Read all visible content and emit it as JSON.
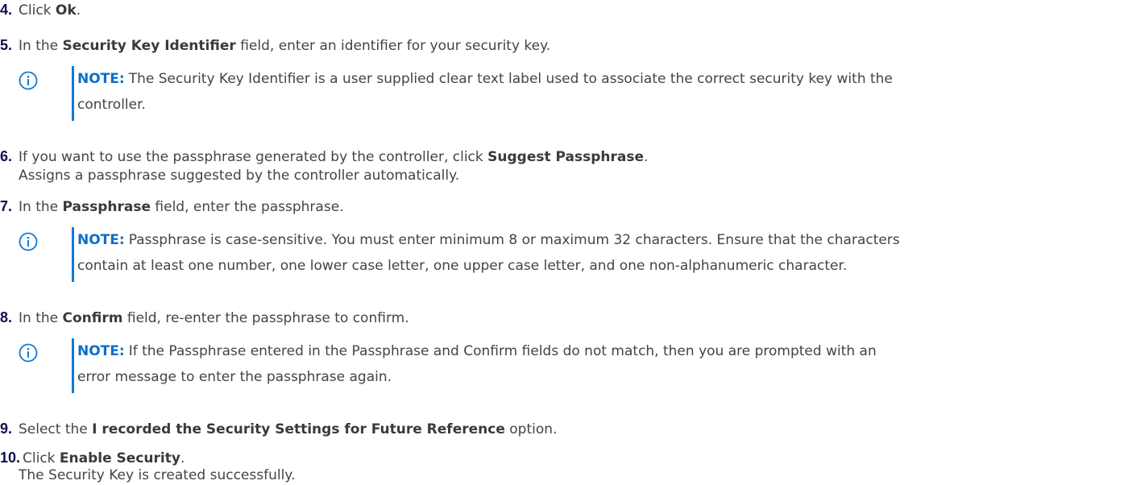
{
  "steps": [
    {
      "number": "4.",
      "before": "Click ",
      "bold": "Ok",
      "after": "."
    },
    {
      "number": "5.",
      "before": "In the ",
      "bold": "Security Key Identifier",
      "after": " field, enter an identifier for your security key."
    },
    {
      "number": "6.",
      "before": "If you want to use the passphrase generated by the controller, click ",
      "bold": "Suggest Passphrase",
      "after": ".",
      "result": "Assigns a passphrase suggested by the controller automatically."
    },
    {
      "number": "7.",
      "before": "In the ",
      "bold": "Passphrase",
      "after": " field, enter the passphrase."
    },
    {
      "number": "8.",
      "before": "In the ",
      "bold": "Confirm",
      "after": " field, re-enter the passphrase to confirm."
    },
    {
      "number": "9.",
      "before": "Select the ",
      "bold": "I recorded the Security Settings for Future Reference",
      "after": " option."
    },
    {
      "number": "10.",
      "before": "Click ",
      "bold": "Enable Security",
      "after": ".",
      "result": "The Security Key is created successfully."
    }
  ],
  "notes": [
    {
      "label": "NOTE:",
      "line1": "The Security Key Identifier is a user supplied clear text label used to associate the correct security key with the",
      "line2": "controller."
    },
    {
      "label": "NOTE:",
      "line1": "Passphrase is case-sensitive. You must enter minimum 8 or maximum 32 characters. Ensure that the characters",
      "line2": "contain at least one number, one lower case letter, one upper case letter, and one non-alphanumeric character."
    },
    {
      "label": "NOTE:",
      "line1": "If the Passphrase entered in the Passphrase and Confirm fields do not match, then you are prompted with an",
      "line2": "error message to enter the passphrase again."
    }
  ],
  "icons": {
    "note": "info-circle-icon"
  },
  "colors": {
    "text": "#444444",
    "step_number": "#0e0e54",
    "note_label": "#0b6fc6",
    "note_bar": "#0b7bd6",
    "icon": "#0b7bd6"
  }
}
